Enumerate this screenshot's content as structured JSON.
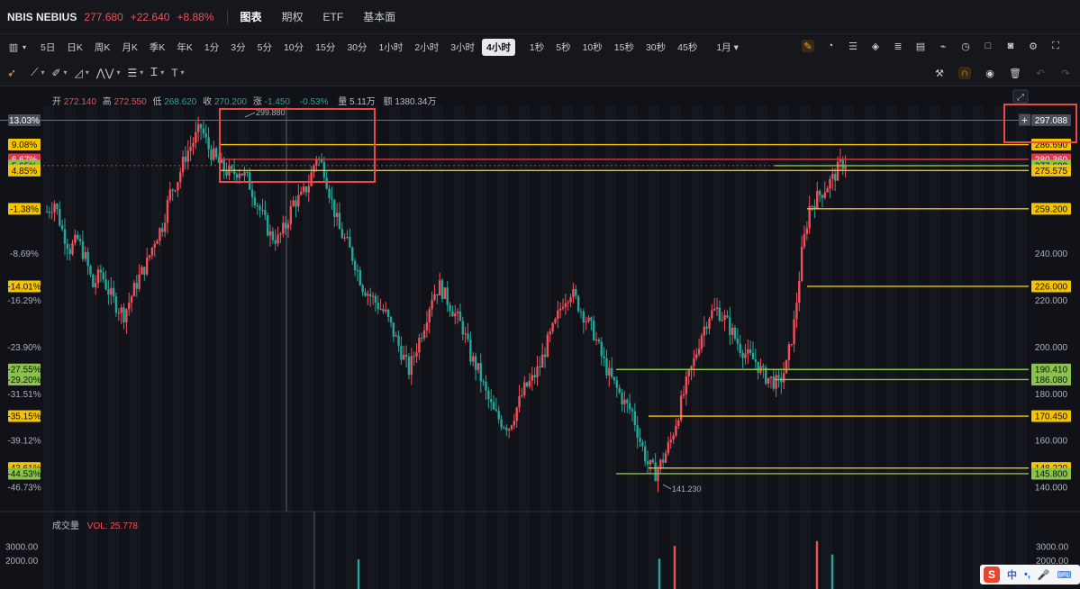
{
  "header": {
    "ticker": "NBIS NEBIUS",
    "price": "277.680",
    "change": "+22.640",
    "pct": "+8.88%",
    "tabs": [
      {
        "label": "图表",
        "active": true
      },
      {
        "label": "期权",
        "active": false
      },
      {
        "label": "ETF",
        "active": false
      },
      {
        "label": "基本面",
        "active": false
      }
    ]
  },
  "timeframes": [
    "5日",
    "日K",
    "周K",
    "月K",
    "季K",
    "年K",
    "1分",
    "3分",
    "5分",
    "10分",
    "15分",
    "30分",
    "1小时",
    "2小时",
    "3小时",
    "4小时",
    "1秒",
    "5秒",
    "10秒",
    "15秒",
    "30秒",
    "45秒",
    "1月"
  ],
  "active_timeframe": "4小时",
  "toolbar_icons": [
    "layout-icon",
    "pen-icon",
    "gauge-icon",
    "stack-icon",
    "layers-icon",
    "list-icon",
    "compare-icon",
    "chart-icon",
    "replay-icon",
    "square-icon",
    "camera-icon",
    "gear-icon",
    "fullscreen-icon"
  ],
  "draw_icons": [
    "cursor-icon",
    "line-tool-icon",
    "brush-icon",
    "ruler-icon",
    "pattern-icon",
    "fib-icon",
    "text-tool-icon",
    "font-icon"
  ],
  "right_icons": [
    "magic-icon",
    "magnet-icon",
    "eye-icon",
    "trash-icon",
    "undo-icon",
    "redo-icon"
  ],
  "info": {
    "open_label": "开",
    "open": "272.140",
    "high_label": "高",
    "high": "272.550",
    "low_label": "低",
    "low": "268.620",
    "close_label": "收",
    "close": "270.200",
    "chg_label": "涨",
    "chg": "-1.450",
    "chg_pct": "-0.53%",
    "vol_label": "量",
    "vol": "5.11万",
    "amt_label": "额",
    "amt": "1380.34万"
  },
  "colors": {
    "up": "#f0505a",
    "down": "#26a69a",
    "yellow": "#f5c400",
    "green": "#8bc34a"
  },
  "chart_data": {
    "type": "candlestick",
    "y_ticks": [
      {
        "value": 240,
        "label": "240.000"
      },
      {
        "value": 220,
        "label": "220.000"
      },
      {
        "value": 200,
        "label": "200.000"
      },
      {
        "value": 180,
        "label": "180.000"
      },
      {
        "value": 160,
        "label": "160.000"
      },
      {
        "value": 140,
        "label": "140.000"
      }
    ],
    "ylim": [
      140,
      300
    ],
    "high_marker": "299.880",
    "low_marker": "141.230",
    "price_levels": [
      {
        "value": 297.088,
        "label": "297.088",
        "pct": "13.03%",
        "color": "gray"
      },
      {
        "value": 286.69,
        "label": "286.690",
        "pct": "9.08%",
        "color": "yellow"
      },
      {
        "value": 280.36,
        "label": "280.360",
        "pct": "6.67%",
        "color": "red"
      },
      {
        "value": 277.68,
        "label": "277.680",
        "pct": "5.65%",
        "color": "green"
      },
      {
        "value": 275.575,
        "label": "275.575",
        "pct": "4.85%",
        "color": "yellow"
      },
      {
        "value": 259.2,
        "label": "259.200",
        "pct": "-1.38%",
        "color": "yellow"
      },
      {
        "value": 226.0,
        "label": "226.000",
        "pct": "-14.01%",
        "color": "yellow"
      },
      {
        "value": 190.41,
        "label": "190.410",
        "pct": "-27.55%",
        "color": "green"
      },
      {
        "value": 186.08,
        "label": "186.080",
        "pct": "-29.20%",
        "color": "green"
      },
      {
        "value": 170.45,
        "label": "170.450",
        "pct": "-35.15%",
        "color": "yellow"
      },
      {
        "value": 148.22,
        "label": "148.220",
        "pct": "-43.61%",
        "color": "yellow"
      },
      {
        "value": 145.8,
        "label": "145.800",
        "pct": "-44.53%",
        "color": "green"
      }
    ],
    "pct_axis": [
      {
        "value": 240,
        "label": "-8.69%"
      },
      {
        "value": 220,
        "label": "-16.29%"
      },
      {
        "value": 200,
        "label": "-23.90%"
      },
      {
        "value": 180,
        "label": "-31.51%"
      },
      {
        "value": 160,
        "label": "-39.12%"
      },
      {
        "value": 140,
        "label": "-46.73%"
      }
    ],
    "close_path": [
      258,
      262,
      250,
      242,
      246,
      238,
      226,
      232,
      224,
      218,
      214,
      222,
      230,
      236,
      246,
      252,
      266,
      272,
      282,
      288,
      294,
      285,
      280,
      276,
      274,
      276,
      272,
      264,
      256,
      248,
      246,
      252,
      262,
      264,
      270,
      282,
      276,
      262,
      250,
      244,
      236,
      226,
      222,
      218,
      214,
      206,
      198,
      190,
      200,
      210,
      222,
      226,
      220,
      214,
      208,
      196,
      190,
      180,
      172,
      168,
      166,
      174,
      182,
      186,
      192,
      202,
      210,
      220,
      224,
      218,
      212,
      206,
      196,
      188,
      182,
      176,
      172,
      160,
      150,
      146,
      152,
      160,
      172,
      184,
      194,
      206,
      214,
      216,
      212,
      206,
      200,
      196,
      194,
      188,
      186,
      184,
      192,
      210,
      240,
      260,
      264,
      268,
      272,
      278,
      280
    ],
    "volume_ticks": [
      {
        "value": 3000,
        "label": "3000.00"
      },
      {
        "value": 2000,
        "label": "2000.00"
      }
    ],
    "volume_label": "成交量",
    "volume_value": "VOL: 25.778"
  }
}
